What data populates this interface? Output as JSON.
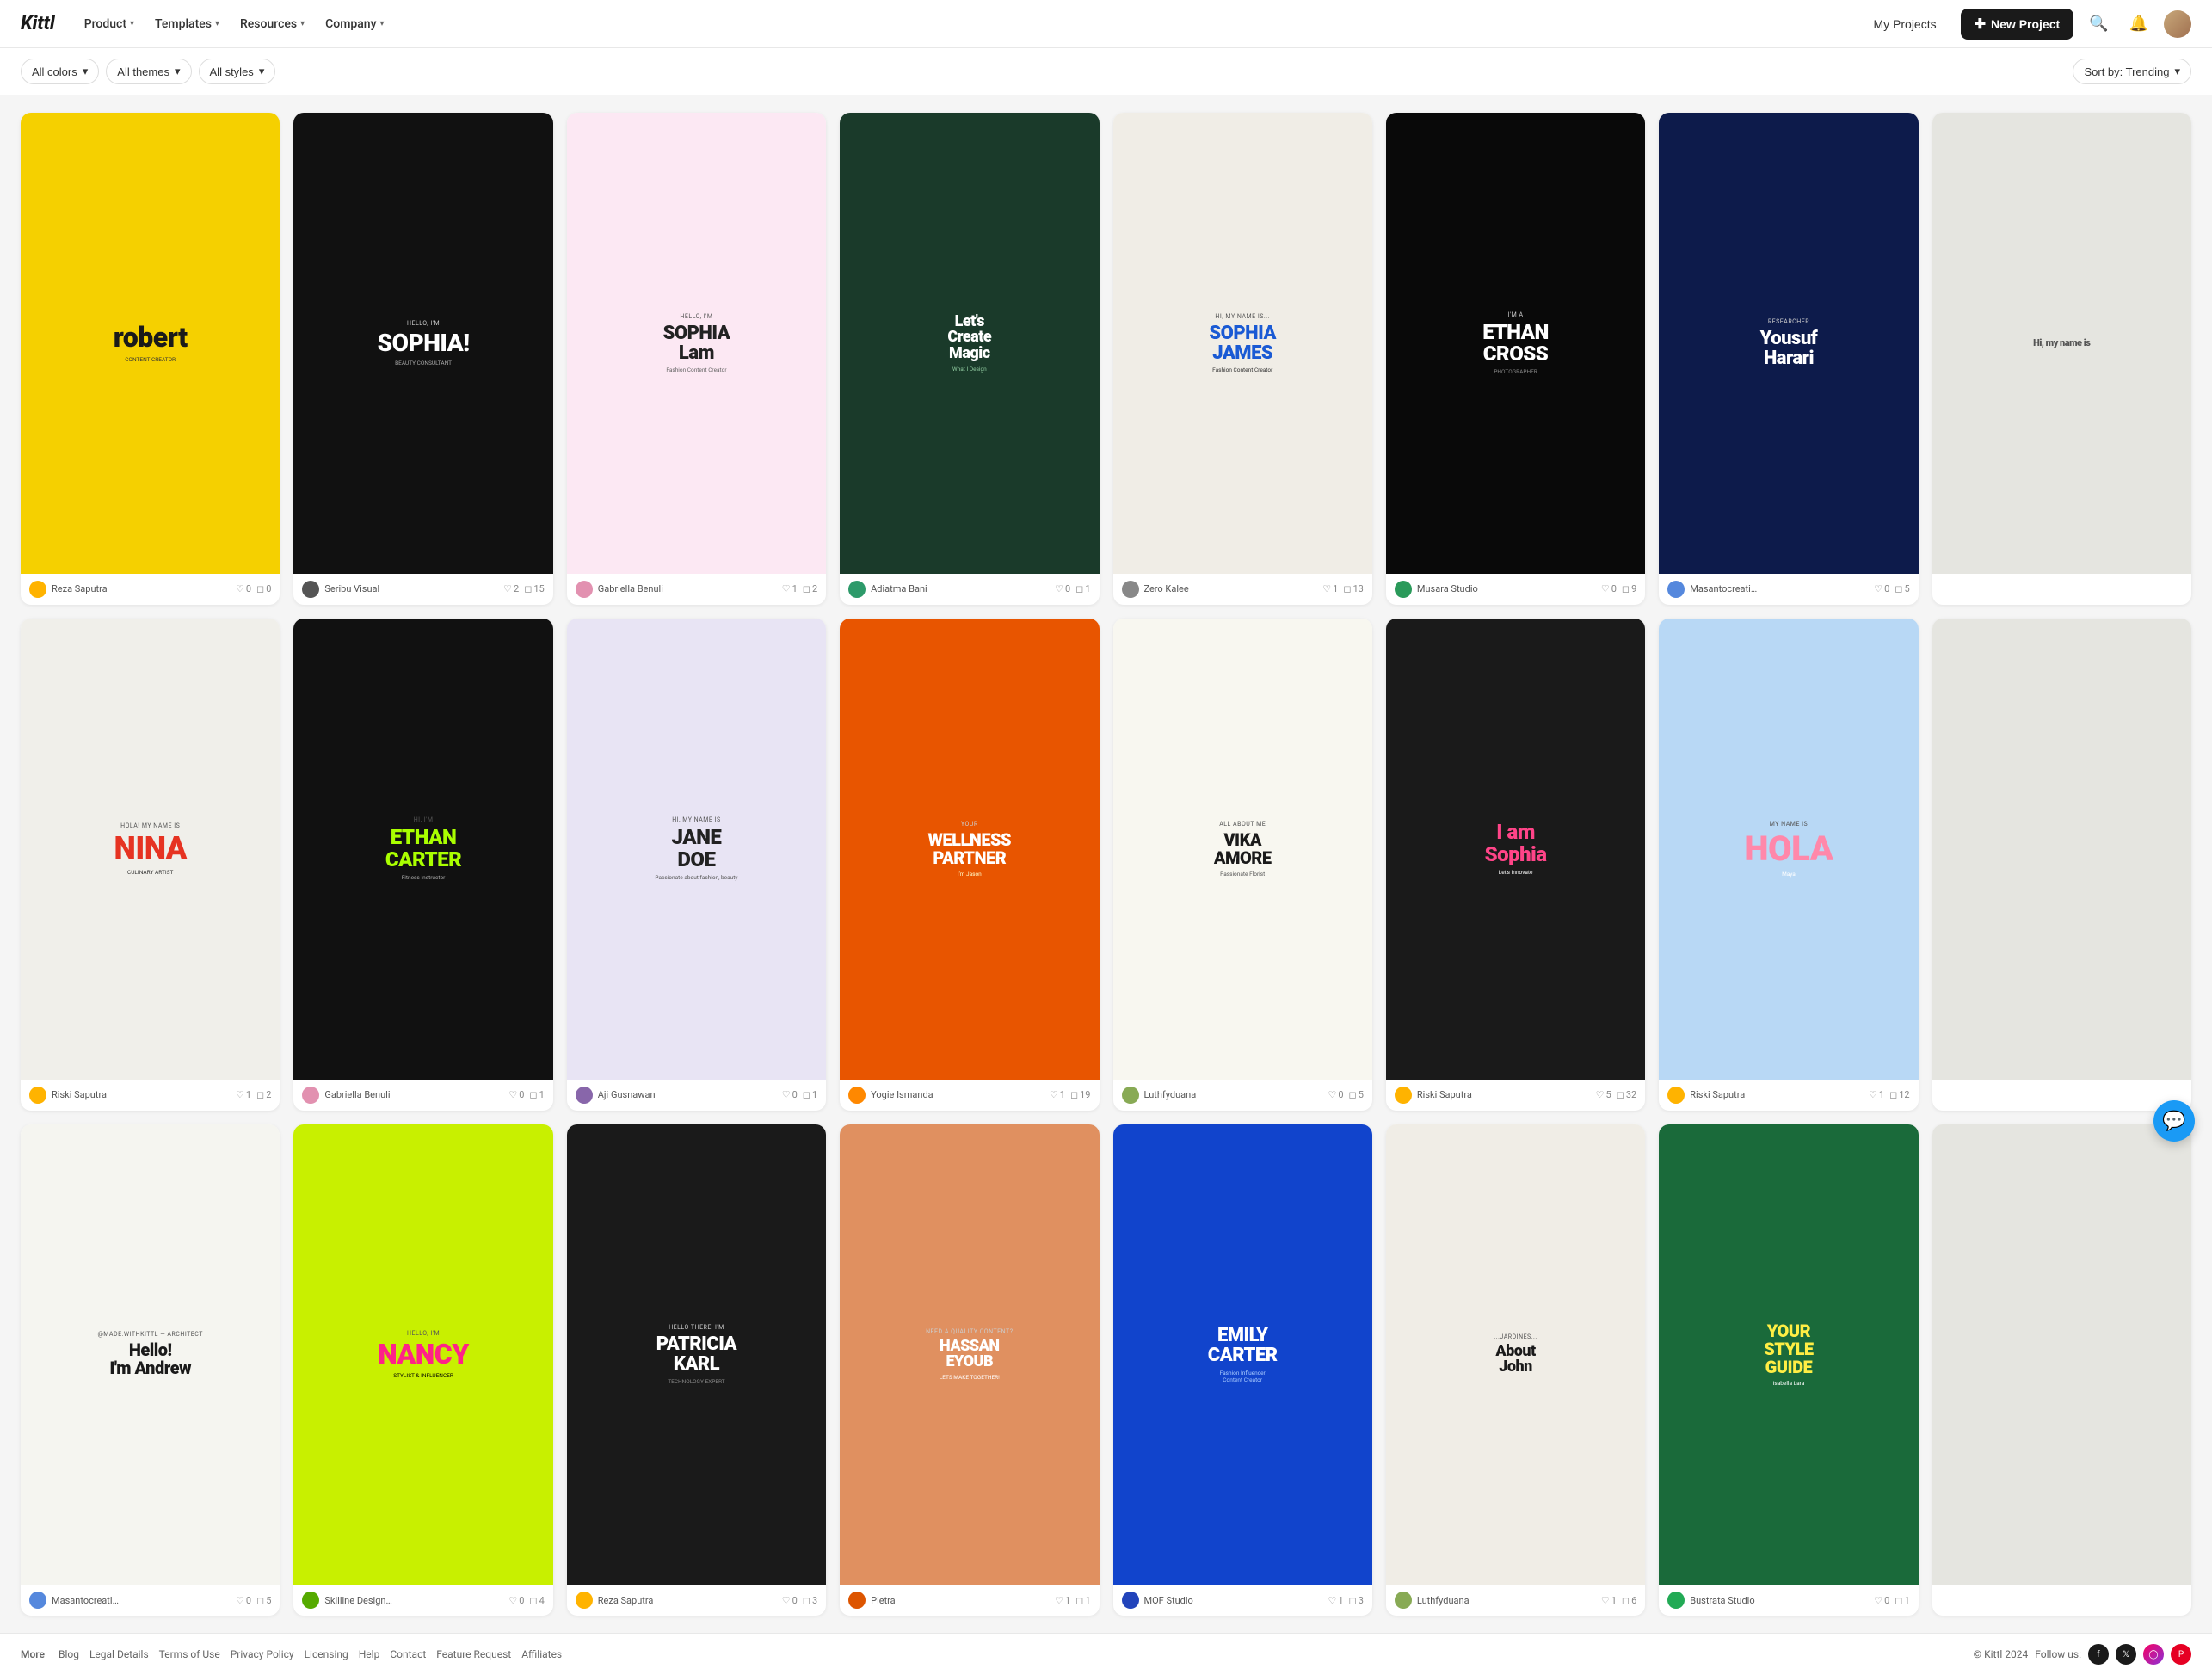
{
  "brand": {
    "logo": "Kittl"
  },
  "nav": {
    "items": [
      {
        "label": "Product",
        "has_dropdown": true
      },
      {
        "label": "Templates",
        "has_dropdown": true
      },
      {
        "label": "Resources",
        "has_dropdown": true
      },
      {
        "label": "Company",
        "has_dropdown": true
      }
    ],
    "my_projects": "My Projects",
    "new_project": "New Project"
  },
  "filters": {
    "colors": "All colors",
    "themes": "All themes",
    "styles": "All styles",
    "sort_label": "Sort by: Trending"
  },
  "cards": [
    {
      "bg": "#f5d000",
      "name": "Reza Saputra",
      "likes": 0,
      "comments": 0,
      "avatar_color": "#ffb300",
      "title": "robert",
      "title_color": "#000",
      "title_size": "28px",
      "sub": "CONTENT CREATOR",
      "sub_color": "#000"
    },
    {
      "bg": "#1a1a1a",
      "name": "Seribu Visual",
      "likes": 2,
      "comments": 15,
      "avatar_color": "#555",
      "title": "SOPHIA!",
      "title_color": "#fff",
      "title_size": "22px",
      "sub": "BEAUTY CONSULTANT",
      "sub_color": "#aaa"
    },
    {
      "bg": "#f9e4f0",
      "name": "Gabriella Benuli",
      "likes": 1,
      "comments": 2,
      "avatar_color": "#e291b0",
      "title": "SOPHIA Lam",
      "title_color": "#222",
      "title_size": "20px",
      "sub": "Fashion Content Creator",
      "sub_color": "#555"
    },
    {
      "bg": "#1a3a2a",
      "name": "Adiatma Bani",
      "likes": 0,
      "comments": 1,
      "avatar_color": "#2d9a6a",
      "title": "Let's Create Magic",
      "title_color": "#fff",
      "title_size": "16px",
      "sub": "What I Design",
      "sub_color": "#ccc"
    },
    {
      "bg": "#f5f0e8",
      "name": "Zero Kalee",
      "likes": 1,
      "comments": 13,
      "avatar_color": "#888",
      "title": "SOPHIA JAMES",
      "title_color": "#1a5ad4",
      "title_size": "20px",
      "sub": "Fashion Content Creator",
      "sub_color": "#333"
    },
    {
      "bg": "#0d0d0d",
      "name": "Musara Studio",
      "likes": 0,
      "comments": 9,
      "avatar_color": "#2a9a5a",
      "title": "ETHAN CROSS",
      "title_color": "#fff",
      "title_size": "22px",
      "sub": "PHOTOGRAPHER",
      "sub_color": "#ccc"
    },
    {
      "bg": "#0d1b4b",
      "name": "Masantocreative",
      "likes": 0,
      "comments": 5,
      "avatar_color": "#5588dd",
      "title": "Yousuf Harari",
      "title_color": "#fff",
      "title_size": "20px",
      "sub": "Researcher",
      "sub_color": "#aac"
    },
    {
      "bg": "#f0efe8",
      "name": "Riski Saputra",
      "likes": 1,
      "comments": 2,
      "avatar_color": "#ffb300",
      "title": "NINA",
      "title_color": "#ff3322",
      "title_size": "28px",
      "sub": "CULINARY ARTIST",
      "sub_color": "#333"
    },
    {
      "bg": "#1a1a1a",
      "name": "Gabriella Benuli",
      "likes": 0,
      "comments": 1,
      "avatar_color": "#e291b0",
      "title": "ETHAN CARTER",
      "title_color": "#aaff00",
      "title_size": "20px",
      "sub": "HI, I'M",
      "sub_color": "#fff"
    },
    {
      "bg": "#e8e0f0",
      "name": "Aji Gusnawan",
      "likes": 0,
      "comments": 1,
      "avatar_color": "#8866aa",
      "title": "JANE DOE",
      "title_color": "#222",
      "title_size": "22px",
      "sub": "Hi, my name is",
      "sub_color": "#555"
    },
    {
      "bg": "#e85500",
      "name": "Yogie Ismanda",
      "likes": 1,
      "comments": 19,
      "avatar_color": "#ff8800",
      "title": "WELLNESS PARTNER",
      "title_color": "#fff",
      "title_size": "18px",
      "sub": "YOUR",
      "sub_color": "#fff"
    },
    {
      "bg": "#f5f5f0",
      "name": "Luthfyduana",
      "likes": 0,
      "comments": 5,
      "avatar_color": "#88aa55",
      "title": "VIKA AMORE",
      "title_color": "#1a1a1a",
      "title_size": "20px",
      "sub": "Passionate Florist",
      "sub_color": "#555"
    },
    {
      "bg": "#1a1a1a",
      "name": "Riski Saputra",
      "likes": 5,
      "comments": 32,
      "avatar_color": "#ffb300",
      "title": "I am Sophia",
      "title_color": "#ff5577",
      "title_size": "22px",
      "sub": "",
      "sub_color": "#fff"
    },
    {
      "bg": "#b0d8f8",
      "name": "Riski Saputra",
      "likes": 1,
      "comments": 12,
      "avatar_color": "#ffb300",
      "title": "HOLA",
      "title_color": "#ff88aa",
      "title_size": "30px",
      "sub": "MY NAME IS Maya",
      "sub_color": "#fff"
    },
    {
      "bg": "#f5f5f0",
      "name": "Masantocreative",
      "likes": 0,
      "comments": 5,
      "avatar_color": "#5588dd",
      "title": "Hello! I'm Andrew",
      "title_color": "#1a1a1a",
      "title_size": "20px",
      "sub": "Architect",
      "sub_color": "#666"
    },
    {
      "bg": "#c8f000",
      "name": "Skilline Design Co.",
      "likes": 0,
      "comments": 4,
      "avatar_color": "#55aa00",
      "title": "NANCY",
      "title_color": "#ff3388",
      "title_size": "26px",
      "sub": "HELLO, I'M",
      "sub_color": "#000"
    },
    {
      "bg": "#1a1a1a",
      "name": "Reza Saputra",
      "likes": 0,
      "comments": 3,
      "avatar_color": "#ffb300",
      "title": "PATRICIA KARL",
      "title_color": "#fff",
      "title_size": "18px",
      "sub": "TECHNOLOGY EXPERT",
      "sub_color": "#aaa"
    },
    {
      "bg": "#e8a070",
      "name": "Pietra",
      "likes": 1,
      "comments": 1,
      "avatar_color": "#dd5500",
      "title": "HASSAN EYOUB",
      "title_color": "#fff",
      "title_size": "18px",
      "sub": "NEED A QUALITY CONTENT?",
      "sub_color": "#fff"
    },
    {
      "bg": "#1a5ad4",
      "name": "MOF Studio",
      "likes": 1,
      "comments": 3,
      "avatar_color": "#2244bb",
      "title": "EMILY CARTER",
      "title_color": "#fff",
      "title_size": "20px",
      "sub": "Fashion Influencer",
      "sub_color": "#aaccff"
    },
    {
      "bg": "#f5f0e8",
      "name": "Luthfyduana",
      "likes": 1,
      "comments": 6,
      "avatar_color": "#88aa55",
      "title": "About John",
      "title_color": "#1a1a1a",
      "title_size": "16px",
      "sub": "Jardines",
      "sub_color": "#666"
    },
    {
      "bg": "#1a6a3a",
      "name": "Bustrata Studio",
      "likes": 0,
      "comments": 1,
      "avatar_color": "#22aa55",
      "title": "YOUR STYLE GUIDE",
      "title_color": "#ffee44",
      "title_size": "18px",
      "sub": "Isabella Lara",
      "sub_color": "#fff"
    }
  ],
  "footer": {
    "more": "More",
    "blog": "Blog",
    "legal_details": "Legal Details",
    "terms": "Terms of Use",
    "privacy": "Privacy Policy",
    "licensing": "Licensing",
    "help": "Help",
    "contact": "Contact",
    "feature_request": "Feature Request",
    "affiliates": "Affiliates",
    "copyright": "© Kittl 2024",
    "follow": "Follow us:"
  }
}
